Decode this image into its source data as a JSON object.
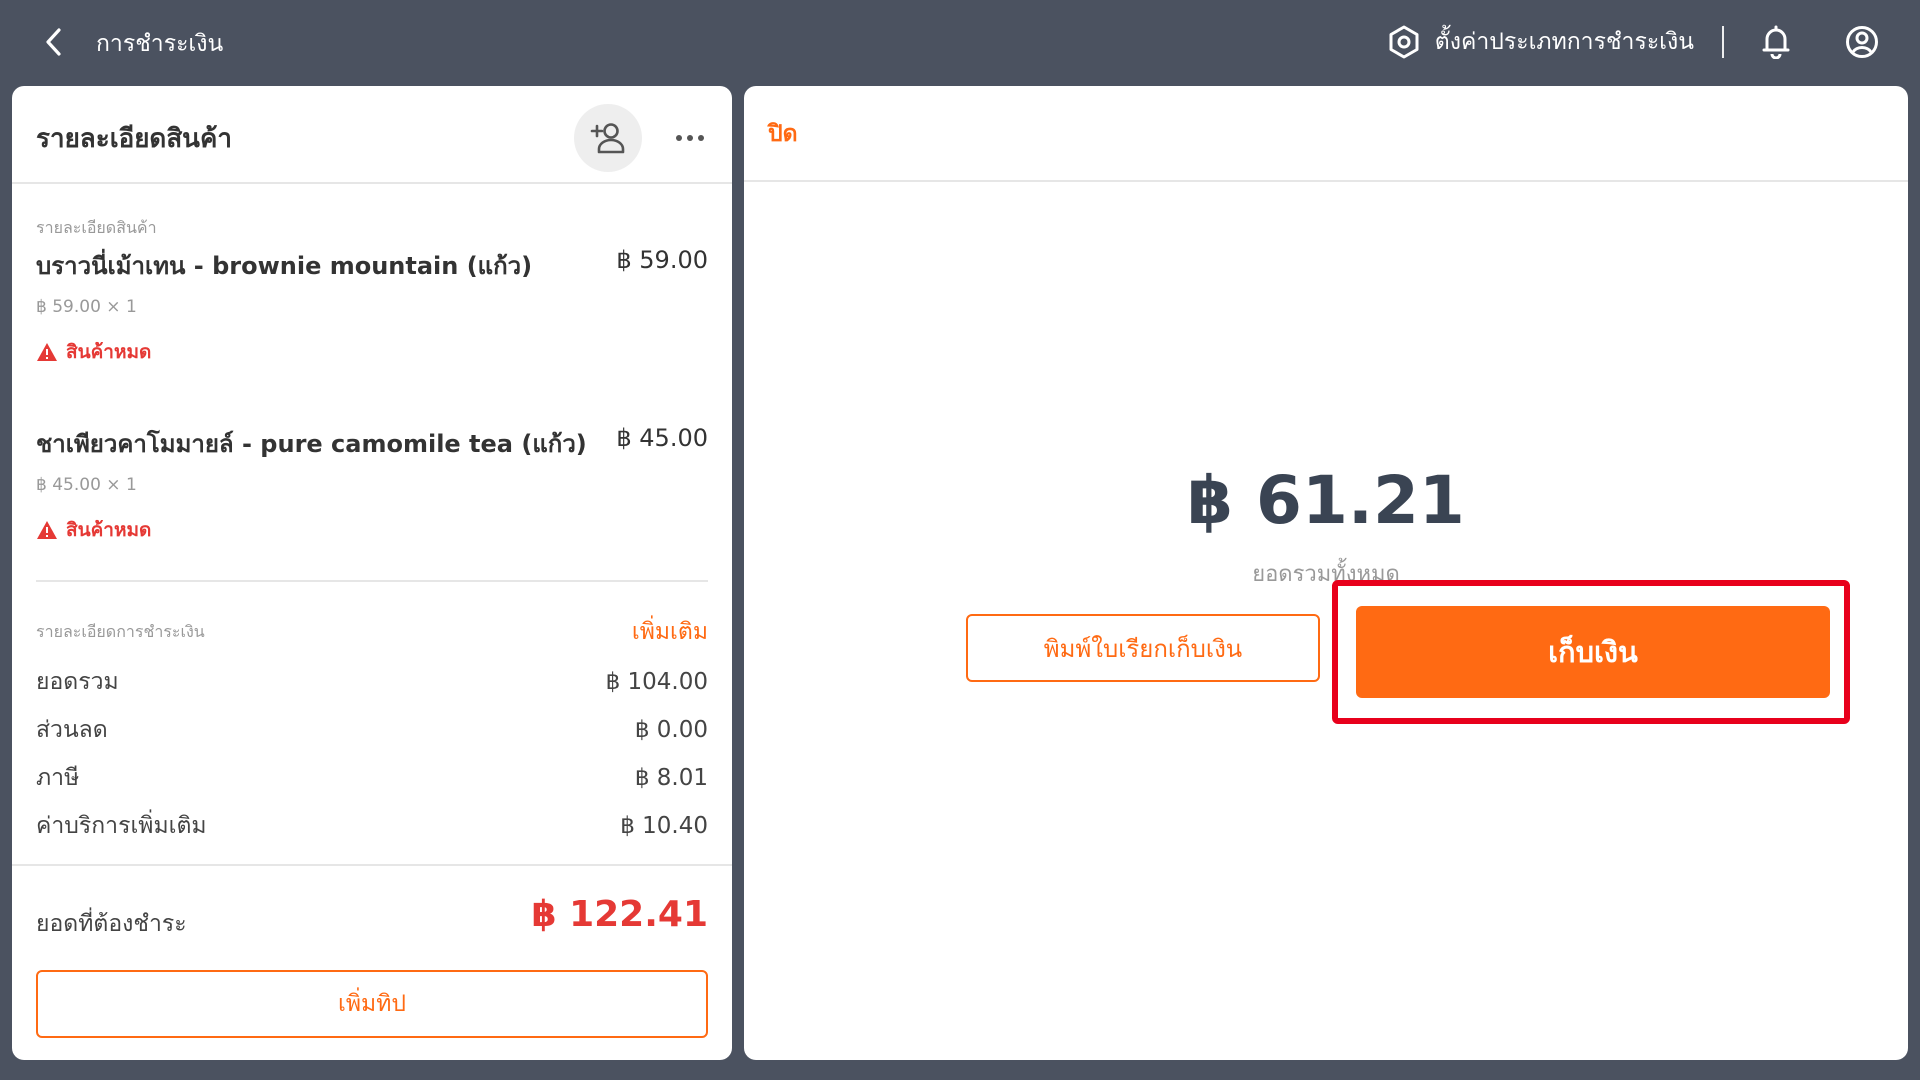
{
  "topbar": {
    "title": "การชำระเงิน",
    "settings_label": "ตั้งค่าประเภทการชำระเงิน"
  },
  "left_panel": {
    "title": "รายละเอียดสินค้า",
    "items_section_label": "รายละเอียดสินค้า",
    "items": [
      {
        "name": "บราวนี่เม้าเทน - brownie mountain (แก้ว)",
        "price": "฿ 59.00",
        "sub": "฿ 59.00 × 1",
        "warning": "สินค้าหมด"
      },
      {
        "name": "ชาเพียวคาโมมายล์ - pure camomile tea (แก้ว)",
        "price": "฿ 45.00",
        "sub": "฿ 45.00 × 1",
        "warning": "สินค้าหมด"
      }
    ],
    "payment_section_label": "รายละเอียดการชำระเงิน",
    "add_more_label": "เพิ่มเติม",
    "summary": [
      {
        "label": "ยอดรวม",
        "value": "฿ 104.00"
      },
      {
        "label": "ส่วนลด",
        "value": "฿ 0.00"
      },
      {
        "label": "ภาษี",
        "value": "฿ 8.01"
      },
      {
        "label": "ค่าบริการเพิ่มเติม",
        "value": "฿ 10.40"
      }
    ],
    "due_label": "ยอดที่ต้องชำระ",
    "due_amount": "฿ 122.41",
    "tip_button": "เพิ่มทิป"
  },
  "right_panel": {
    "close_label": "ปิด",
    "total_amount": "฿ 61.21",
    "total_label": "ยอดรวมทั้งหมด",
    "print_button": "พิมพ์ใบเรียกเก็บเงิน",
    "collect_button": "เก็บเงิน"
  },
  "colors": {
    "accent": "#ff6a13",
    "alert": "#e53935",
    "topbar_bg": "#4b5260",
    "highlight": "#e8001c"
  },
  "icons": {
    "back": "chevron-left-icon",
    "settings": "hexagon-settings-icon",
    "notifications": "bell-icon",
    "account": "user-circle-icon",
    "add_customer": "add-person-icon",
    "more": "more-dots-icon",
    "warning": "warning-triangle-icon"
  }
}
